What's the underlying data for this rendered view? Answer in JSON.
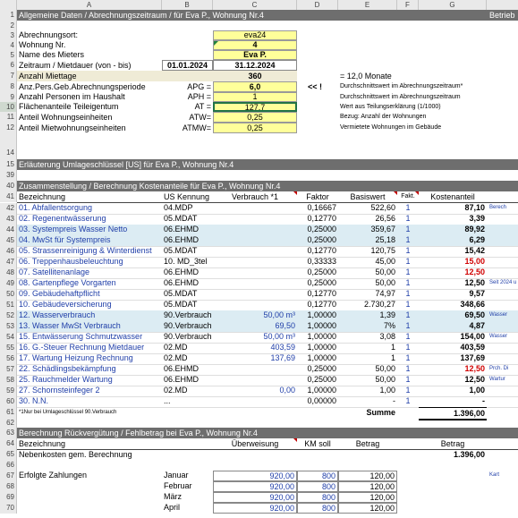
{
  "columns": [
    "A",
    "B",
    "C",
    "D",
    "E",
    "F",
    "G"
  ],
  "rows": {
    "r1": {
      "num": "1",
      "title": "Allgemeine Daten / Abrechnungszeitraum / für Eva P., Wohnung Nr.4",
      "right": "Betrieb"
    },
    "r2": {
      "num": "2"
    },
    "r3": {
      "num": "3",
      "label": "Abrechnungsort:",
      "value": "eva24"
    },
    "r4": {
      "num": "4",
      "label": "Wohnung Nr.",
      "value": "4"
    },
    "r5": {
      "num": "5",
      "label": "Name des Mieters",
      "value": "Eva P."
    },
    "r6": {
      "num": "6",
      "label": "Zeitraum / Mietdauer (von - bis)",
      "from": "01.01.2024",
      "to": "31.12.2024"
    },
    "r7": {
      "num": "7",
      "label": "Anzahl Miettage",
      "value": "360",
      "note": "= 12,0 Monate"
    },
    "r8": {
      "num": "8",
      "label": "Anz.Pers.Geb.Abrechnungsperiode",
      "code": "APG =",
      "value": "6,0",
      "arrow": "<< !",
      "note": "Durchschnittswert im Abrechnungszeitraum*"
    },
    "r9": {
      "num": "9",
      "label": "Anzahl Personen im Haushalt",
      "code": "APH =",
      "value": "1",
      "note": "Durchschnittswert im Abrechnungszeitraum"
    },
    "r10": {
      "num": "10",
      "label": "Flächenanteile Teileigentum",
      "code": "AT =",
      "value": "127,7",
      "note": "Wert aus Teilungserklärung (1/1000)"
    },
    "r11": {
      "num": "11",
      "label": "Anteil Wohnungseinheiten",
      "code": "ATW=",
      "value": "0,25",
      "note": "Bezug: Anzahl der Wohnungen"
    },
    "r12": {
      "num": "12",
      "label": "Anteil Mietwohnungseinheiten",
      "code": "ATMW=",
      "value": "0,25",
      "note": "Vermietete Wohnungen im Gebäude"
    },
    "r14": {
      "num": "14"
    },
    "r15": {
      "num": "15",
      "title": "Erläuterung Umlageschlüssel [US] für Eva P., Wohnung Nr.4"
    },
    "r39": {
      "num": "39"
    },
    "r40": {
      "num": "40",
      "title": "Zusammenstellung / Berechnung Kostenanteile für Eva P., Wohnung Nr.4"
    },
    "r41": {
      "num": "41",
      "h1": "Bezeichnung",
      "h2": "US Kennung",
      "h3": "Verbrauch *1",
      "h4": "Faktor",
      "h5": "Basiswert",
      "h6": "Fakt.",
      "h7": "Kostenanteil"
    }
  },
  "costs": [
    {
      "num": "42",
      "name": "01. Abfallentsorgung",
      "us": "04.MDP",
      "verbrauch": "",
      "faktor": "0,16667",
      "basis": "522,60",
      "fakt": "1",
      "anteil": "87,10",
      "red": false,
      "blue": false,
      "side": "Berech"
    },
    {
      "num": "43",
      "name": "02. Regenentwässerung",
      "us": "05.MDAT",
      "verbrauch": "",
      "faktor": "0,12770",
      "basis": "26,56",
      "fakt": "1",
      "anteil": "3,39",
      "red": false,
      "blue": false,
      "side": ""
    },
    {
      "num": "44",
      "name": "03. Systempreis Wasser Netto",
      "us": "06.EHMD",
      "verbrauch": "",
      "faktor": "0,25000",
      "basis": "359,67",
      "fakt": "1",
      "anteil": "89,92",
      "red": false,
      "blue": true,
      "side": ""
    },
    {
      "num": "45",
      "name": "04. MwSt für Systempreis",
      "us": "06.EHMD",
      "verbrauch": "",
      "faktor": "0,25000",
      "basis": "25,18",
      "fakt": "1",
      "anteil": "6,29",
      "red": false,
      "blue": true,
      "side": ""
    },
    {
      "num": "46",
      "name": "05. Strassenreinigung & Winterdienst",
      "us": "05.MDAT",
      "verbrauch": "",
      "faktor": "0,12770",
      "basis": "120,75",
      "fakt": "1",
      "anteil": "15,42",
      "red": false,
      "blue": false,
      "side": ""
    },
    {
      "num": "47",
      "name": "06. Treppenhausbeleuchtung",
      "us": "10. MD_3tel",
      "verbrauch": "",
      "faktor": "0,33333",
      "basis": "45,00",
      "fakt": "1",
      "anteil": "15,00",
      "red": true,
      "blue": false,
      "side": ""
    },
    {
      "num": "48",
      "name": "07. Satellitenanlage",
      "us": "06.EHMD",
      "verbrauch": "",
      "faktor": "0,25000",
      "basis": "50,00",
      "fakt": "1",
      "anteil": "12,50",
      "red": true,
      "blue": false,
      "side": ""
    },
    {
      "num": "49",
      "name": "08. Gartenpflege Vorgarten",
      "us": "06.EHMD",
      "verbrauch": "",
      "faktor": "0,25000",
      "basis": "50,00",
      "fakt": "1",
      "anteil": "12,50",
      "red": false,
      "blue": false,
      "side": "Seit 2024 u"
    },
    {
      "num": "50",
      "name": "09. Gebäudehaftpflicht",
      "us": "05.MDAT",
      "verbrauch": "",
      "faktor": "0,12770",
      "basis": "74,97",
      "fakt": "1",
      "anteil": "9,57",
      "red": false,
      "blue": false,
      "side": ""
    },
    {
      "num": "51",
      "name": "10. Gebäudeversicherung",
      "us": "05.MDAT",
      "verbrauch": "",
      "faktor": "0,12770",
      "basis": "2.730,27",
      "fakt": "1",
      "anteil": "348,66",
      "red": false,
      "blue": false,
      "side": ""
    },
    {
      "num": "52",
      "name": "12. Wasserverbrauch",
      "us": "90.Verbrauch",
      "verbrauch": "50,00 m³",
      "faktor": "1,00000",
      "basis": "1,39",
      "fakt": "1",
      "anteil": "69,50",
      "red": false,
      "blue": true,
      "side": "Wasser"
    },
    {
      "num": "53",
      "name": "13. Wasser MwSt Verbrauch",
      "us": "90.Verbrauch",
      "verbrauch": "69,50",
      "faktor": "1,00000",
      "basis": "7%",
      "fakt": "1",
      "anteil": "4,87",
      "red": false,
      "blue": true,
      "side": ""
    },
    {
      "num": "54",
      "name": "15. Entwässerung Schmutzwasser",
      "us": "90.Verbrauch",
      "verbrauch": "50,00 m³",
      "faktor": "1,00000",
      "basis": "3,08",
      "fakt": "1",
      "anteil": "154,00",
      "red": false,
      "blue": false,
      "side": "Wasser"
    },
    {
      "num": "55",
      "name": "16. G.-Steuer Rechnung Mietdauer",
      "us": "02.MD",
      "verbrauch": "403,59",
      "faktor": "1,00000",
      "basis": "1",
      "fakt": "1",
      "anteil": "403,59",
      "red": false,
      "blue": false,
      "side": ""
    },
    {
      "num": "56",
      "name": "17. Wartung Heizung Rechnung",
      "us": "02.MD",
      "verbrauch": "137,69",
      "faktor": "1,00000",
      "basis": "1",
      "fakt": "1",
      "anteil": "137,69",
      "red": false,
      "blue": false,
      "side": ""
    },
    {
      "num": "57",
      "name": "22. Schädlingsbekämpfung",
      "us": "06.EHMD",
      "verbrauch": "",
      "faktor": "0,25000",
      "basis": "50,00",
      "fakt": "1",
      "anteil": "12,50",
      "red": true,
      "blue": false,
      "side": "Prch. Di"
    },
    {
      "num": "58",
      "name": "25. Rauchmelder Wartung",
      "us": "06.EHMD",
      "verbrauch": "",
      "faktor": "0,25000",
      "basis": "50,00",
      "fakt": "1",
      "anteil": "12,50",
      "red": false,
      "blue": false,
      "side": "Wartur"
    },
    {
      "num": "59",
      "name": "27. Schornsteinfeger 2",
      "us": "02.MD",
      "verbrauch": "0,00",
      "faktor": "1,00000",
      "basis": "1,00",
      "fakt": "1",
      "anteil": "1,00",
      "red": false,
      "blue": false,
      "side": ""
    },
    {
      "num": "60",
      "name": "30. N.N.",
      "us": "...",
      "verbrauch": "",
      "faktor": "0,00000",
      "basis": "-",
      "fakt": "1",
      "anteil": "-",
      "red": false,
      "blue": false,
      "side": ""
    }
  ],
  "sum": {
    "num": "61",
    "footnote": "*1Nur bei Umlageschlüssel 90.Verbrauch",
    "label": "Summe",
    "value": "1.396,00"
  },
  "r62": {
    "num": "62"
  },
  "r63": {
    "num": "63",
    "title": "Berechnung Rückvergütung / Fehlbetrag bei Eva P., Wohnung Nr.4"
  },
  "r64": {
    "num": "64",
    "h1": "Bezeichnung",
    "h2": "Überweisung",
    "h3": "KM soll",
    "h4": "Betrag",
    "h5": "Betrag"
  },
  "r65": {
    "num": "65",
    "label": "Nebenkosten gem. Berechnung",
    "value": "1.396,00"
  },
  "r66": {
    "num": "66"
  },
  "payments": [
    {
      "num": "67",
      "label": "Erfolgte Zahlungen",
      "month": "Januar",
      "ueb": "920,00",
      "km": "800",
      "betrag": "120,00",
      "side": "Kart"
    },
    {
      "num": "68",
      "label": "",
      "month": "Februar",
      "ueb": "920,00",
      "km": "800",
      "betrag": "120,00",
      "side": ""
    },
    {
      "num": "69",
      "label": "",
      "month": "März",
      "ueb": "920,00",
      "km": "800",
      "betrag": "120,00",
      "side": ""
    },
    {
      "num": "70",
      "label": "",
      "month": "April",
      "ueb": "920,00",
      "km": "800",
      "betrag": "120,00",
      "side": ""
    }
  ]
}
